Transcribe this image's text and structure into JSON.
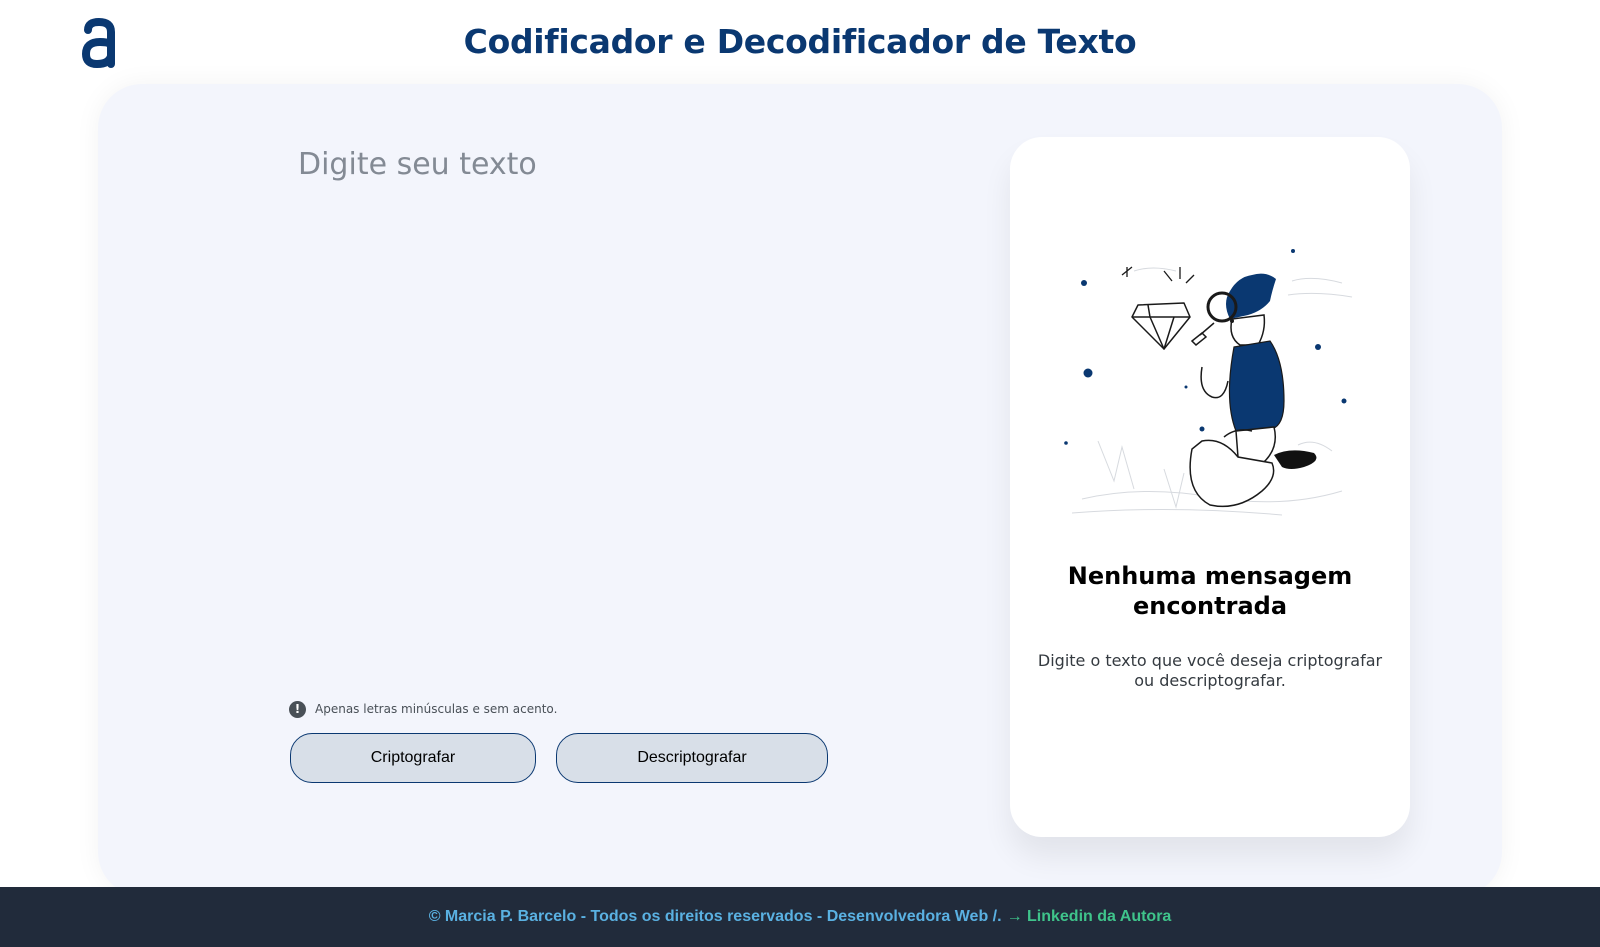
{
  "header": {
    "logo_icon": "alura-logo-icon",
    "title": "Codificador e Decodificador de Texto"
  },
  "input": {
    "placeholder": "Digite seu texto",
    "value": ""
  },
  "hint": {
    "icon": "exclamation-circle-icon",
    "text": "Apenas letras minúsculas e sem acento."
  },
  "buttons": {
    "encrypt_label": "Criptografar",
    "decrypt_label": "Descriptografar"
  },
  "output": {
    "illustration": "person-with-magnifying-glass-illustration",
    "title": "Nenhuma mensagem encontrada",
    "description": "Digite o texto que você deseja criptografar ou descriptografar."
  },
  "footer": {
    "copyright": "© Marcia P. Barcelo - Todos os direitos reservados - Desenvolvedora Web /.",
    "link_label": "→ Linkedin da Autora"
  },
  "colors": {
    "primary": "#0a3871",
    "panel_bg": "#f3f5fc",
    "button_bg": "#d8dfe8",
    "footer_bg": "#212b3b",
    "footer_text": "#5ab1e2",
    "footer_link": "#3fc48b"
  }
}
